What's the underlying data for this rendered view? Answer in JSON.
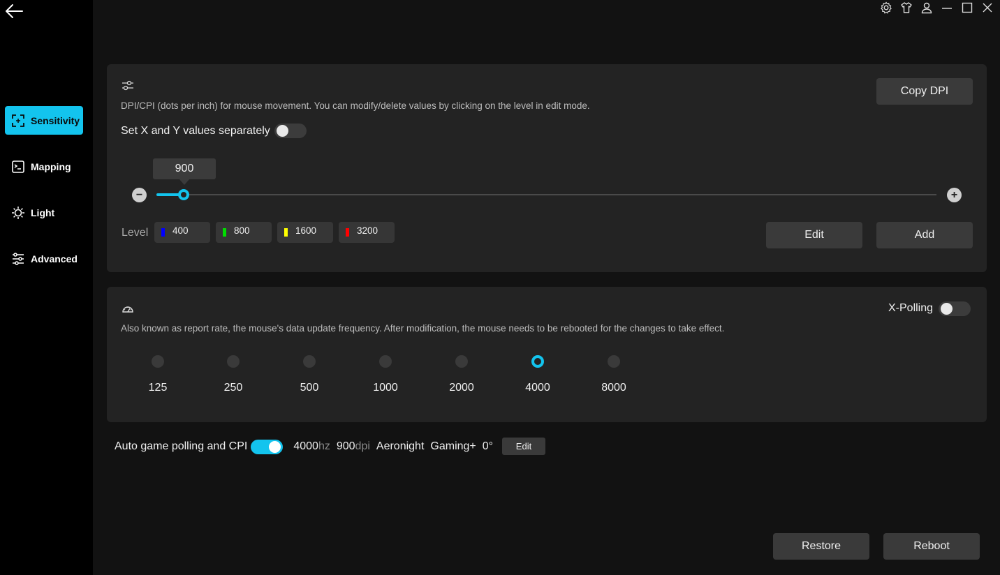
{
  "nav": {
    "items": [
      {
        "label": "Sensitivity",
        "icon": "sensitivity-icon",
        "active": true
      },
      {
        "label": "Mapping",
        "icon": "mapping-icon",
        "active": false
      },
      {
        "label": "Light",
        "icon": "light-icon",
        "active": false
      },
      {
        "label": "Advanced",
        "icon": "advanced-icon",
        "active": false
      }
    ]
  },
  "titlebar": {
    "icons": [
      "settings-icon",
      "shirt-icon",
      "user-icon",
      "minimize-icon",
      "maximize-icon",
      "close-icon"
    ]
  },
  "dpi": {
    "description": "DPI/CPI (dots per inch) for mouse movement. You can modify/delete values by clicking on the level in edit mode.",
    "copy_label": "Copy DPI",
    "xy_label": "Set X and Y values separately",
    "xy_enabled": false,
    "current_value": "900",
    "slider_fraction": 0.035,
    "level_label": "Level",
    "levels": [
      {
        "value": "400",
        "color": "#0000ff"
      },
      {
        "value": "800",
        "color": "#00dd00"
      },
      {
        "value": "1600",
        "color": "#ffff00"
      },
      {
        "value": "3200",
        "color": "#ff0000"
      }
    ],
    "edit_label": "Edit",
    "add_label": "Add"
  },
  "polling": {
    "description": "Also known as report rate, the mouse's data update frequency. After modification, the mouse needs to be rebooted for the changes to take effect.",
    "xpolling_label": "X-Polling",
    "xpolling_enabled": false,
    "rates": [
      "125",
      "250",
      "500",
      "1000",
      "2000",
      "4000",
      "8000"
    ],
    "selected": "4000"
  },
  "auto": {
    "label": "Auto game polling and CPI",
    "enabled": true,
    "hz_value": "4000",
    "hz_unit": "hz",
    "dpi_value": "900",
    "dpi_unit": "dpi",
    "game": "Aeronight",
    "mode": "Gaming+",
    "angle": "0°",
    "edit_label": "Edit"
  },
  "footer": {
    "restore_label": "Restore",
    "reboot_label": "Reboot"
  },
  "colors": {
    "accent": "#13c4ee",
    "panel": "#232323",
    "background": "#121212"
  }
}
